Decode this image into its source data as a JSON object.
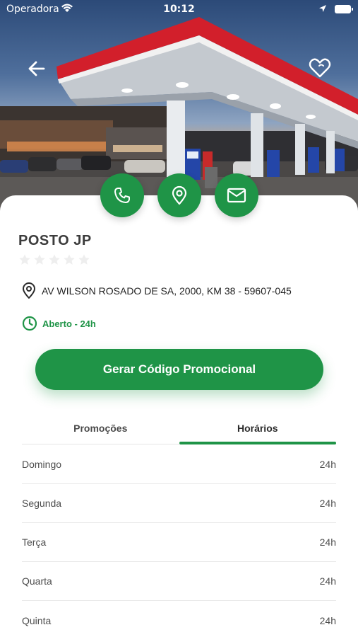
{
  "status_bar": {
    "carrier": "Operadora",
    "time": "10:12"
  },
  "station": {
    "name": "POSTO JP",
    "rating": 0,
    "rating_max": 5,
    "address": "AV WILSON ROSADO DE SA, 2000, KM 38 - 59607-045",
    "hours_status": "Aberto - 24h"
  },
  "actions": {
    "icons": [
      "phone-icon",
      "map-pin-icon",
      "mail-icon"
    ]
  },
  "promo_button_label": "Gerar Código Promocional",
  "tabs": [
    {
      "label": "Promoções",
      "active": false
    },
    {
      "label": "Horários",
      "active": true
    }
  ],
  "schedule": [
    {
      "day": "Domingo",
      "hours": "24h"
    },
    {
      "day": "Segunda",
      "hours": "24h"
    },
    {
      "day": "Terça",
      "hours": "24h"
    },
    {
      "day": "Quarta",
      "hours": "24h"
    },
    {
      "day": "Quinta",
      "hours": "24h"
    }
  ],
  "colors": {
    "primary": "#1f9447",
    "canopy_red": "#d21f2b"
  }
}
